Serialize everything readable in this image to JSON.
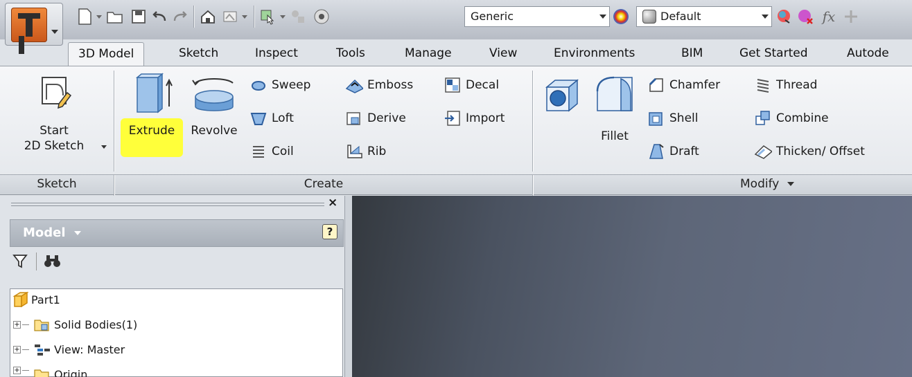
{
  "quick_access": {
    "material": "Generic",
    "appearance": "Default",
    "fx_label": "fx"
  },
  "tabs": [
    "3D Model",
    "Sketch",
    "Inspect",
    "Tools",
    "Manage",
    "View",
    "Environments",
    "BIM",
    "Get Started",
    "Autode"
  ],
  "ribbon": {
    "sketch_panel": {
      "title": "Sketch",
      "start_sketch_line1": "Start",
      "start_sketch_line2": "2D Sketch"
    },
    "create_panel": {
      "title": "Create",
      "extrude": "Extrude",
      "revolve": "Revolve",
      "sweep": "Sweep",
      "loft": "Loft",
      "coil": "Coil",
      "emboss": "Emboss",
      "derive": "Derive",
      "rib": "Rib",
      "decal": "Decal",
      "import": "Import"
    },
    "modify_panel": {
      "title": "Modify",
      "hole": "Hole",
      "fillet": "Fillet",
      "chamfer": "Chamfer",
      "shell": "Shell",
      "draft": "Draft",
      "thread": "Thread",
      "combine": "Combine",
      "thicken_offset": "Thicken/ Offset"
    }
  },
  "browser": {
    "title": "Model",
    "help": "?",
    "close": "×",
    "tree": [
      "Part1",
      "Solid Bodies(1)",
      "View: Master",
      "Origin"
    ]
  },
  "colors": {
    "highlight": "#ffff3a",
    "accent_blue": "#2f78c4",
    "viewport_dark": "#34393f",
    "viewport_light": "#677086"
  }
}
